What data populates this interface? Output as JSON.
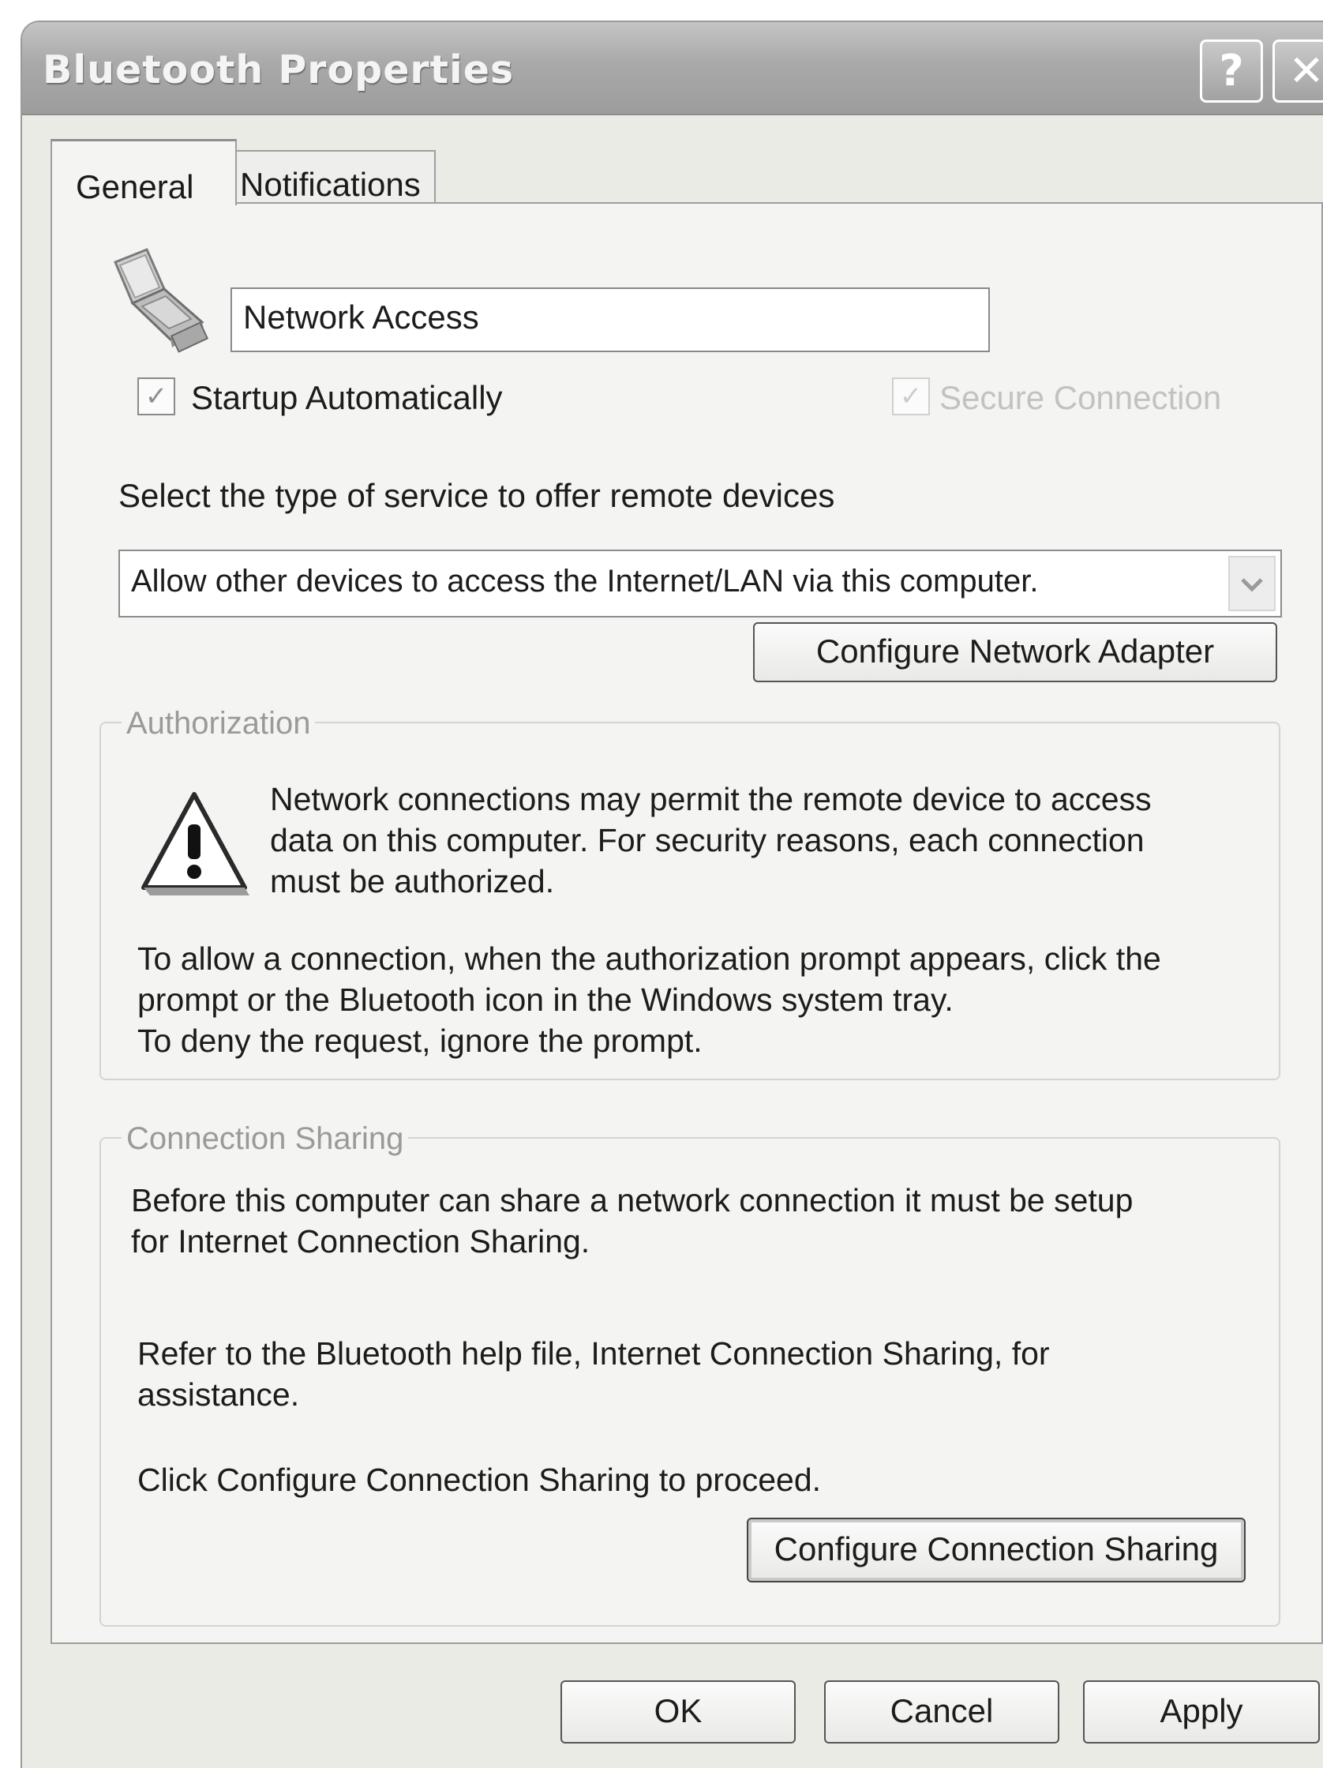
{
  "window": {
    "title": "Bluetooth Properties",
    "help_glyph": "?",
    "close_glyph": "✕"
  },
  "tabs": [
    {
      "label": "General",
      "selected": true
    },
    {
      "label": "Notifications",
      "selected": false
    }
  ],
  "general": {
    "service_icon": "laptop-device-icon",
    "service_name": "Network Access",
    "startup_auto": {
      "label": "Startup Automatically",
      "checked": true
    },
    "secure_connection": {
      "label": "Secure Connection",
      "checked": true,
      "enabled": false
    },
    "service_type_label": "Select the type of service to offer remote devices",
    "service_type_value": "Allow other devices to access the Internet/LAN via this computer.",
    "configure_adapter_label": "Configure Network Adapter"
  },
  "authorization": {
    "legend": "Authorization",
    "icon": "warning-icon",
    "warning_lines": [
      "Network connections may permit the remote device to access",
      "data on this computer.  For security reasons, each connection",
      "must be authorized."
    ],
    "instruction_lines": [
      "To allow a connection, when the authorization prompt appears, click the",
      "prompt or the Bluetooth icon in the Windows system tray.",
      "To deny the request, ignore the prompt."
    ]
  },
  "connection_sharing": {
    "legend": "Connection Sharing",
    "intro_lines": [
      "Before this computer can share a network connection it must be setup",
      "for Internet Connection Sharing."
    ],
    "refer_lines": [
      "Refer to the Bluetooth help file, Internet Connection Sharing, for",
      "assistance."
    ],
    "proceed_text": "Click Configure Connection Sharing to proceed.",
    "configure_button_label": "Configure Connection Sharing"
  },
  "footer": {
    "ok_label": "OK",
    "cancel_label": "Cancel",
    "apply_label": "Apply"
  }
}
